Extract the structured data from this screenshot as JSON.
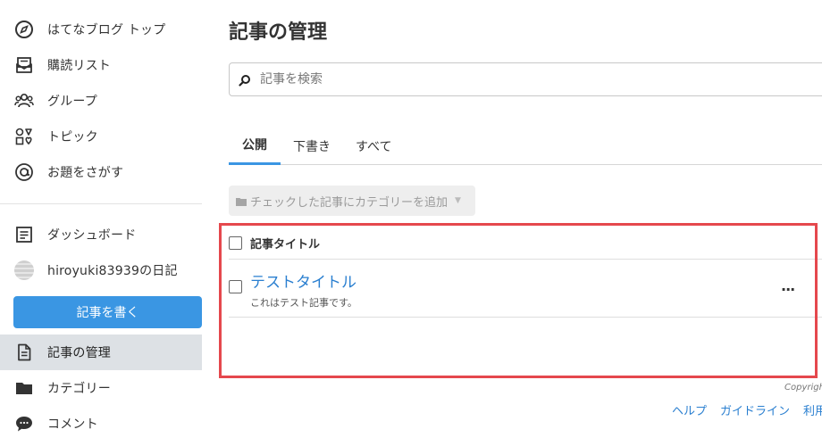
{
  "sidebar": {
    "top_items": [
      {
        "label": "はてなブログ トップ",
        "icon": "compass-icon"
      },
      {
        "label": "購読リスト",
        "icon": "reader-icon"
      },
      {
        "label": "グループ",
        "icon": "group-icon"
      },
      {
        "label": "トピック",
        "icon": "topic-shapes-icon"
      },
      {
        "label": "お題をさがす",
        "icon": "at-theme-icon"
      }
    ],
    "dashboard": {
      "label": "ダッシュボード",
      "icon": "dashboard-icon"
    },
    "blog": {
      "label": "hiroyuki83939の日記",
      "icon": "avatar"
    },
    "write_button": "記事を書く",
    "manage": {
      "label": "記事の管理",
      "icon": "document-icon"
    },
    "category": {
      "label": "カテゴリー",
      "icon": "folder-icon"
    },
    "comment": {
      "label": "コメント",
      "icon": "comment-icon"
    }
  },
  "main": {
    "title": "記事の管理",
    "search": {
      "placeholder": "記事を検索",
      "value": ""
    },
    "tabs": [
      {
        "label": "公開",
        "active": true
      },
      {
        "label": "下書き",
        "active": false
      },
      {
        "label": "すべて",
        "active": false
      }
    ],
    "category_button": "チェックした記事にカテゴリーを追加",
    "table": {
      "header": "記事タイトル",
      "rows": [
        {
          "title": "テストタイトル",
          "excerpt": "これはテスト記事です。",
          "menu": "..."
        }
      ]
    }
  },
  "footer": {
    "copyright": "Copyright",
    "links": [
      "ヘルプ",
      "ガイドライン",
      "利用規約"
    ]
  },
  "colors": {
    "accent": "#3a96e3",
    "link": "#2a7fd0",
    "highlight_border": "#e5484d",
    "active_nav_bg": "#dde1e5"
  }
}
